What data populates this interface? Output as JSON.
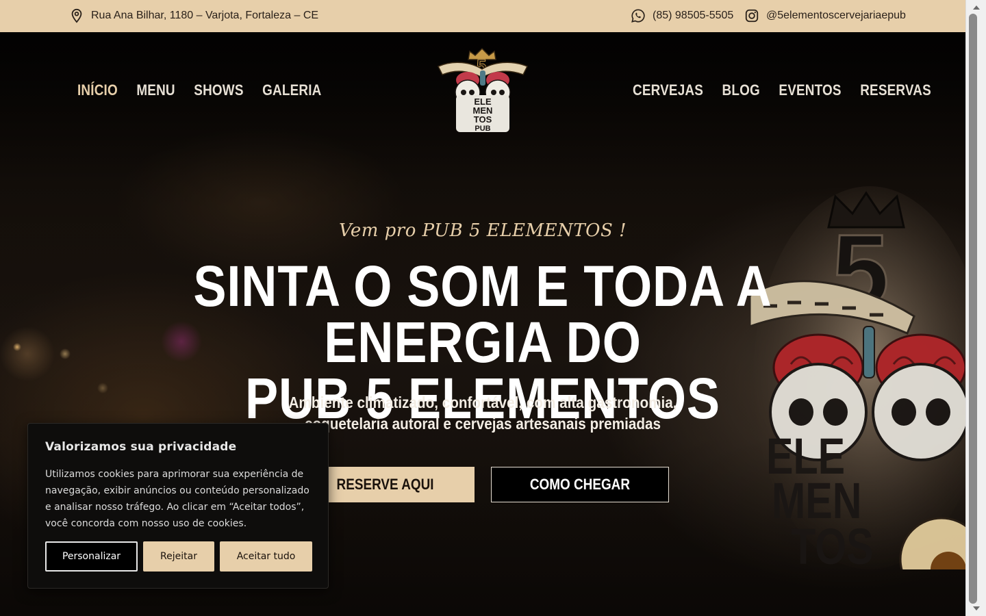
{
  "topbar": {
    "address": "Rua Ana Bilhar, 1180 – Varjota, Fortaleza – CE",
    "phone": "(85) 98505-5505",
    "instagram": "@5elementoscervejariaepub"
  },
  "nav": {
    "left": [
      "INÍCIO",
      "MENU",
      "SHOWS",
      "GALERIA"
    ],
    "right": [
      "CERVEJAS",
      "BLOG",
      "EVENTOS",
      "RESERVAS"
    ]
  },
  "logo": {
    "lines": [
      "ELE",
      "MEN",
      "TOS",
      "PUB"
    ],
    "number": "5"
  },
  "hero": {
    "tagline": "Vem pro PUB 5 ELEMENTOS !",
    "headline_line1": "SINTA O SOM E TODA A ENERGIA DO",
    "headline_line2": "PUB 5 ELEMENTOS",
    "subline_line1": "Ambiente climatizado, confortável, com alta gastronomia,",
    "subline_line2": "coquetelaria autoral e cervejas artesanais premiadas",
    "btn_reserve": "RESERVE AQUI",
    "btn_route": "COMO CHEGAR"
  },
  "cookie": {
    "title": "Valorizamos sua privacidade",
    "body": "Utilizamos cookies para aprimorar sua experiência de navegação, exibir anúncios ou conteúdo personalizado e analisar nosso tráfego. Ao clicar em “Aceitar todos”, você concorda com nosso uso de cookies.",
    "btn_customize": "Personalizar",
    "btn_reject": "Rejeitar",
    "btn_accept": "Aceitar tudo"
  },
  "colors": {
    "accent": "#e7cfaa",
    "dark": "#0e0d0c"
  },
  "icons": [
    "location-pin-icon",
    "whatsapp-icon",
    "instagram-icon"
  ]
}
